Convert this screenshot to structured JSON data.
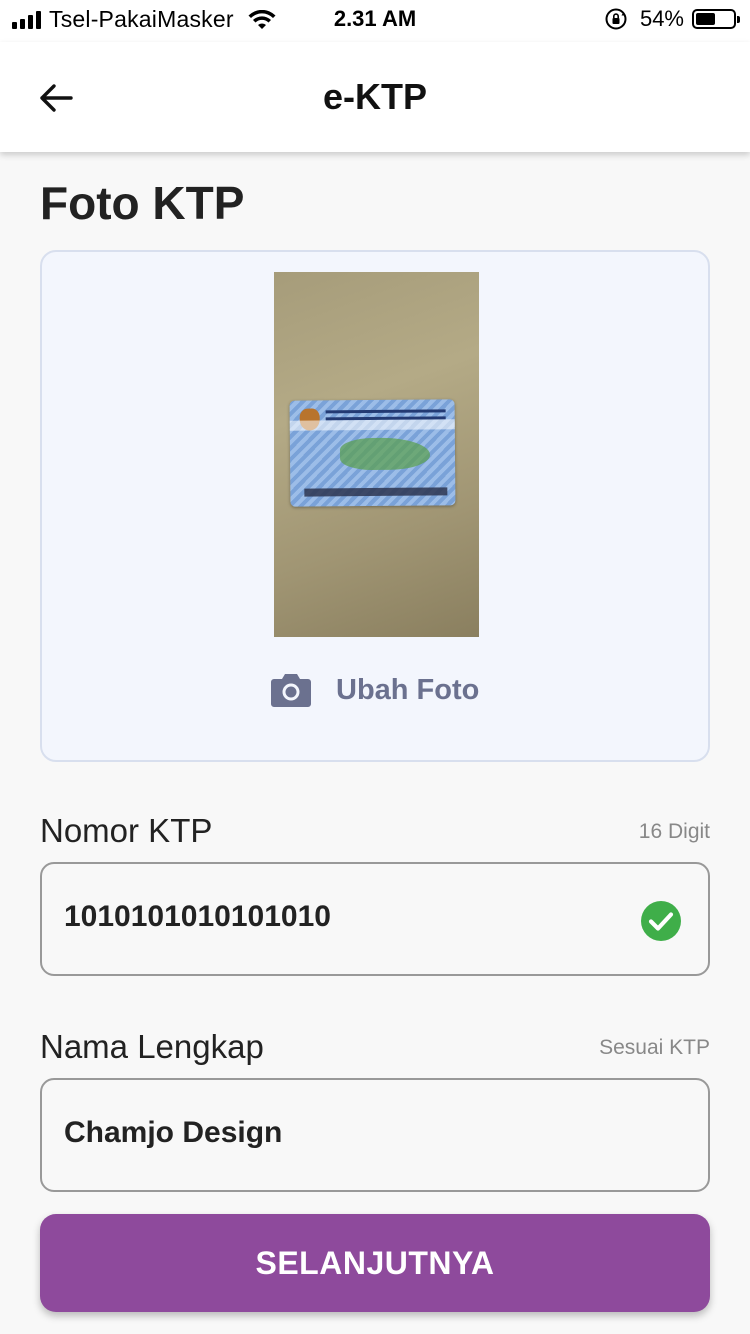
{
  "status_bar": {
    "carrier": "Tsel-PakaiMasker",
    "time": "2.31 AM",
    "battery_percent": "54%",
    "battery_level": 0.54,
    "icons": [
      "signal-icon",
      "wifi-icon",
      "rotation-lock-icon",
      "battery-icon"
    ]
  },
  "app_bar": {
    "title": "e-KTP",
    "back_icon": "arrow-left-icon"
  },
  "photo_section": {
    "title": "Foto KTP",
    "change_photo_label": "Ubah Foto",
    "change_photo_icon": "camera-icon"
  },
  "fields": {
    "nomor_ktp": {
      "label": "Nomor KTP",
      "hint": "16 Digit",
      "value": "1010101010101010",
      "status_icon": "check-circle-icon"
    },
    "nama_lengkap": {
      "label": "Nama Lengkap",
      "hint": "Sesuai KTP",
      "value": "Chamjo Design"
    }
  },
  "actions": {
    "next_label": "SELANJUTNYA"
  },
  "colors": {
    "accent": "#8e4a9c",
    "card_background": "#f3f6fd",
    "success": "#3fae49",
    "muted_icon": "#6b718f"
  }
}
